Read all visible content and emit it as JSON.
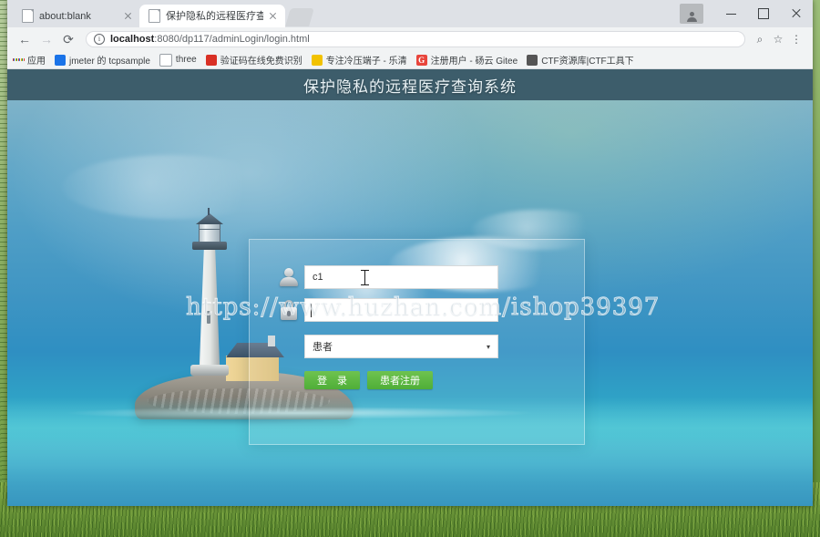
{
  "window": {
    "controls": {
      "minimize": "—",
      "maximize": "☐",
      "close": "✕"
    },
    "user_icon": "account-icon"
  },
  "tabs": [
    {
      "title": "about:blank",
      "active": false,
      "close": "✕"
    },
    {
      "title": "保护隐私的远程医疗查询",
      "active": true,
      "close": "✕"
    }
  ],
  "toolbar": {
    "back": "←",
    "forward": "→",
    "reload": "⟳",
    "info_icon": "i",
    "url_host": "localhost",
    "url_rest": ":8080/dp117/adminLogin/login.html",
    "search_icon": "⌕",
    "star_icon": "☆",
    "menu_icon": "⋮"
  },
  "bookmarks": [
    {
      "label": "应用",
      "icon": "apps-grid-icon"
    },
    {
      "label": "jmeter 的 tcpsample",
      "icon": "shield-icon"
    },
    {
      "label": "three",
      "icon": "page-icon"
    },
    {
      "label": "验证码在线免费识别",
      "icon": "red-circle-icon"
    },
    {
      "label": "专注冷压端子 - 乐清",
      "icon": "yellow-icon"
    },
    {
      "label": "注册用户 - 砀云 Gitee",
      "icon": "gitee-g-icon"
    },
    {
      "label": "CTF资源库|CTF工具下",
      "icon": "person-icon"
    }
  ],
  "page": {
    "header_title": "保护隐私的远程医疗查询系统",
    "watermark": "https://www.huzhan.com/ishop39397",
    "header_bg": "#3d5d6b",
    "button_green": "#55b23b"
  },
  "login": {
    "username": {
      "value": "c1",
      "placeholder": "",
      "icon": "user-icon"
    },
    "password": {
      "value": "",
      "placeholder": "",
      "icon": "lock-icon"
    },
    "role": {
      "selected": "患者",
      "arrow": "▾"
    },
    "login_button": "登　录",
    "register_button": "患者注册"
  }
}
